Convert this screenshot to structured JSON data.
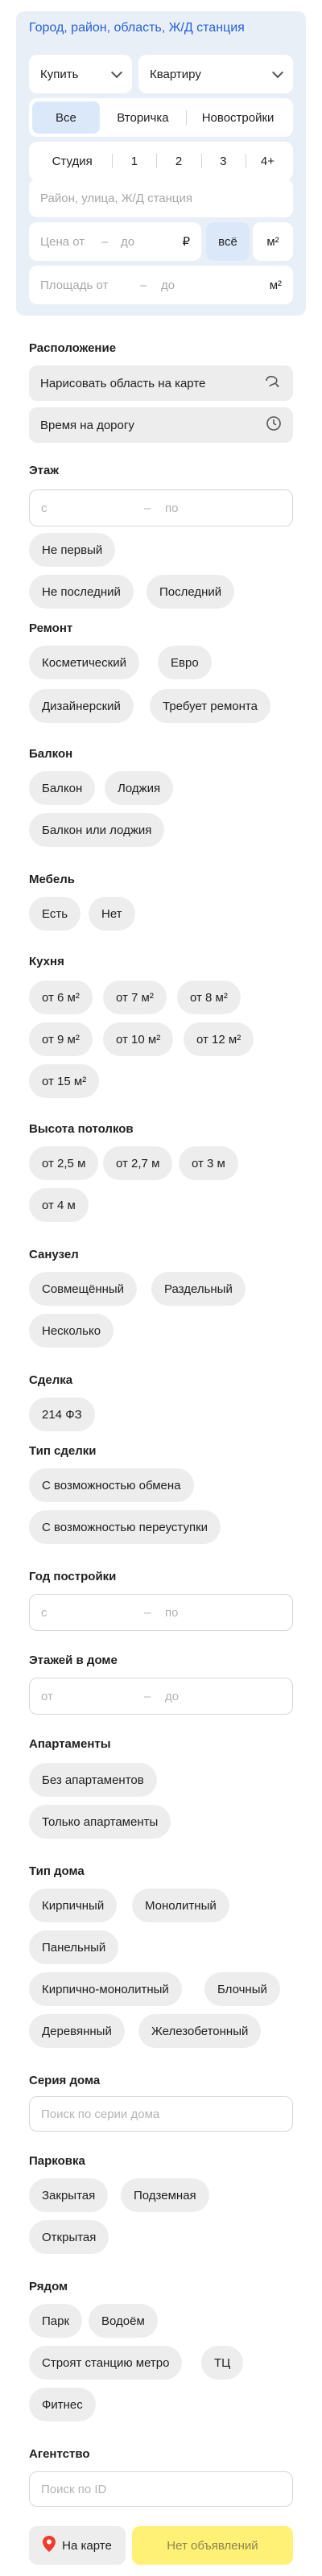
{
  "header": {
    "location_link": "Город, район, область, Ж/Д станция"
  },
  "deal_select": {
    "value": "Купить"
  },
  "type_select": {
    "value": "Квартиру"
  },
  "market_tabs": [
    "Все",
    "Вторичка",
    "Новостройки"
  ],
  "rooms_tabs": [
    "Студия",
    "1",
    "2",
    "3",
    "4+"
  ],
  "address_input": {
    "placeholder": "Район, улица, Ж/Д станция"
  },
  "price": {
    "from": "Цена от",
    "dash": "–",
    "to": "до",
    "unit": "₽",
    "all_toggle": "всё",
    "m2_toggle": "м²"
  },
  "area": {
    "from": "Площадь от",
    "dash": "–",
    "to": "до",
    "unit": "м²"
  },
  "location": {
    "title": "Расположение",
    "draw_area": "Нарисовать область на карте",
    "travel_time": "Время на дорогу"
  },
  "floor": {
    "title": "Этаж",
    "from": "с",
    "dash": "–",
    "to": "по",
    "options": [
      "Не первый",
      "Не последний",
      "Последний"
    ]
  },
  "renovation": {
    "title": "Ремонт",
    "options": [
      "Косметический",
      "Евро",
      "Дизайнерский",
      "Требует ремонта"
    ]
  },
  "balcony": {
    "title": "Балкон",
    "options": [
      "Балкон",
      "Лоджия",
      "Балкон или лоджия"
    ]
  },
  "furniture": {
    "title": "Мебель",
    "options": [
      "Есть",
      "Нет"
    ]
  },
  "kitchen": {
    "title": "Кухня",
    "options": [
      "от 6 м²",
      "от 7 м²",
      "от 8 м²",
      "от 9 м²",
      "от 10 м²",
      "от 12 м²",
      "от 15 м²"
    ]
  },
  "ceiling": {
    "title": "Высота потолков",
    "options": [
      "от 2,5 м",
      "от 2,7 м",
      "от 3 м",
      "от 4 м"
    ]
  },
  "bathroom": {
    "title": "Санузел",
    "options": [
      "Совмещённый",
      "Раздельный",
      "Несколько"
    ]
  },
  "deal": {
    "title": "Сделка",
    "options": [
      "214 ФЗ"
    ]
  },
  "deal_type": {
    "title": "Тип сделки",
    "options": [
      "С возможностью обмена",
      "С возможностью переуступки"
    ]
  },
  "build_year": {
    "title": "Год постройки",
    "from": "с",
    "dash": "–",
    "to": "по"
  },
  "floors_total": {
    "title": "Этажей в доме",
    "from": "от",
    "dash": "–",
    "to": "до"
  },
  "apartments": {
    "title": "Апартаменты",
    "options": [
      "Без апартаментов",
      "Только апартаменты"
    ]
  },
  "house_type": {
    "title": "Тип дома",
    "options": [
      "Кирпичный",
      "Монолитный",
      "Панельный",
      "Кирпично-монолитный",
      "Блочный",
      "Деревянный",
      "Железобетонный"
    ]
  },
  "house_series": {
    "title": "Серия дома",
    "placeholder": "Поиск по серии дома"
  },
  "parking": {
    "title": "Парковка",
    "options": [
      "Закрытая",
      "Подземная",
      "Открытая"
    ]
  },
  "nearby": {
    "title": "Рядом",
    "options": [
      "Парк",
      "Водоём",
      "Строят станцию метро",
      "ТЦ",
      "Фитнес"
    ]
  },
  "agency": {
    "title": "Агентство",
    "placeholder": "Поиск по ID"
  },
  "bottom": {
    "map_label": "На карте",
    "results_label": "Нет объявлений"
  },
  "colors": {
    "accent_link": "#2560d8",
    "panel_bg": "#e8eff7",
    "chip_bg": "#ededed",
    "cta_yellow": "#fff176",
    "pin_red": "#f03a2e"
  }
}
